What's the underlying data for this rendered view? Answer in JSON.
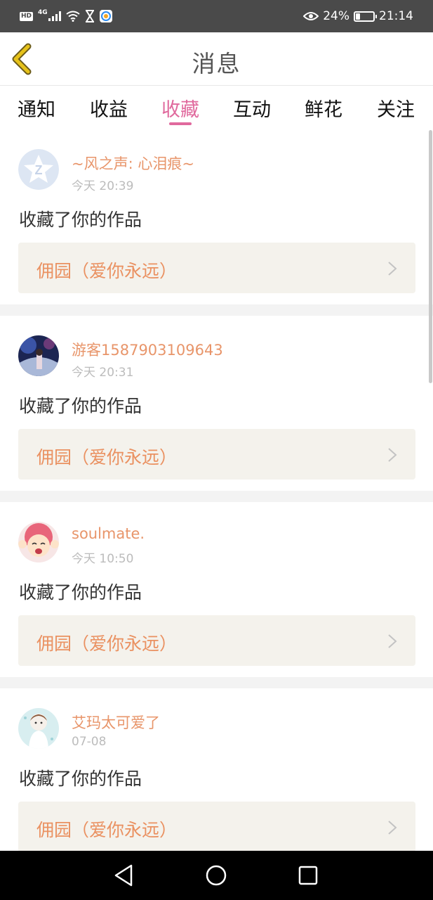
{
  "status_bar": {
    "hd_label": "HD",
    "network_label": "4G",
    "battery_percent": "24%",
    "battery_level": 0.24,
    "time": "21:14",
    "icons": [
      "hd-icon",
      "signal-icon",
      "wifi-icon",
      "hourglass-icon",
      "app-icon",
      "eye-icon",
      "battery-icon"
    ]
  },
  "header": {
    "back_icon": "chevron-left-icon",
    "title": "消息",
    "accent_color": "#e0699d"
  },
  "tabs": [
    {
      "label": "通知",
      "active": false
    },
    {
      "label": "收益",
      "active": false
    },
    {
      "label": "收藏",
      "active": true
    },
    {
      "label": "互动",
      "active": false
    },
    {
      "label": "鲜花",
      "active": false
    },
    {
      "label": "关注",
      "active": false
    }
  ],
  "messages": [
    {
      "username": "~风之声: 心泪痕~",
      "time": "今天 20:39",
      "action": "收藏了你的作品",
      "work_title": "佣园（爱你永远）"
    },
    {
      "username": "游客1587903109643",
      "time": "今天 20:31",
      "action": "收藏了你的作品",
      "work_title": "佣园（爱你永远）"
    },
    {
      "username": "soulmate.",
      "time": "今天 10:50",
      "action": "收藏了你的作品",
      "work_title": "佣园（爱你永远）"
    },
    {
      "username": "艾玛太可爱了",
      "time": "07-08",
      "action": "收藏了你的作品",
      "work_title": "佣园（爱你永远）"
    }
  ],
  "colors": {
    "username": "#e8956a",
    "work_title": "#ea9161",
    "work_background": "#f4f2ec",
    "back_icon": "#e6c21a"
  },
  "nav_bar": {
    "icons": [
      "back-triangle-icon",
      "home-circle-icon",
      "recents-square-icon"
    ]
  }
}
